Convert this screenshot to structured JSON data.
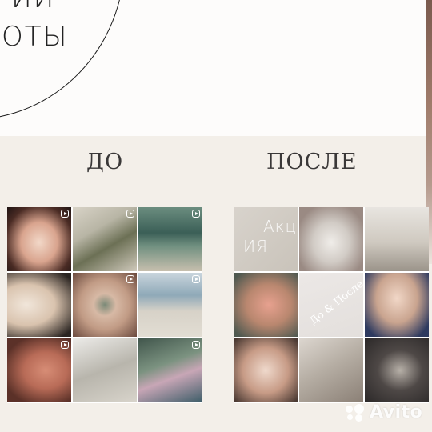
{
  "title": {
    "line1": "ИИ",
    "line2": "ОТЫ"
  },
  "labels": {
    "before": "ДО",
    "after": "ПОСЛЕ"
  },
  "grid_before": {
    "tiles": [
      {
        "icon": "reel-icon"
      },
      {
        "icon": "reel-icon"
      },
      {
        "icon": "reel-icon"
      },
      {
        "icon": ""
      },
      {
        "icon": "reel-icon"
      },
      {
        "icon": "reel-icon"
      },
      {
        "icon": "reel-icon"
      },
      {
        "icon": ""
      },
      {
        "icon": "reel-icon"
      }
    ]
  },
  "grid_after": {
    "tile1_text_a": "Акц",
    "tile1_text_b": "ИЯ",
    "tile5_text": "До & После"
  },
  "watermark": {
    "brand": "Avito",
    "icon": "avito-dots-logo"
  },
  "colors": {
    "background": "#f3efe9",
    "top_background": "#fdfcfb",
    "text": "#3a3838"
  }
}
